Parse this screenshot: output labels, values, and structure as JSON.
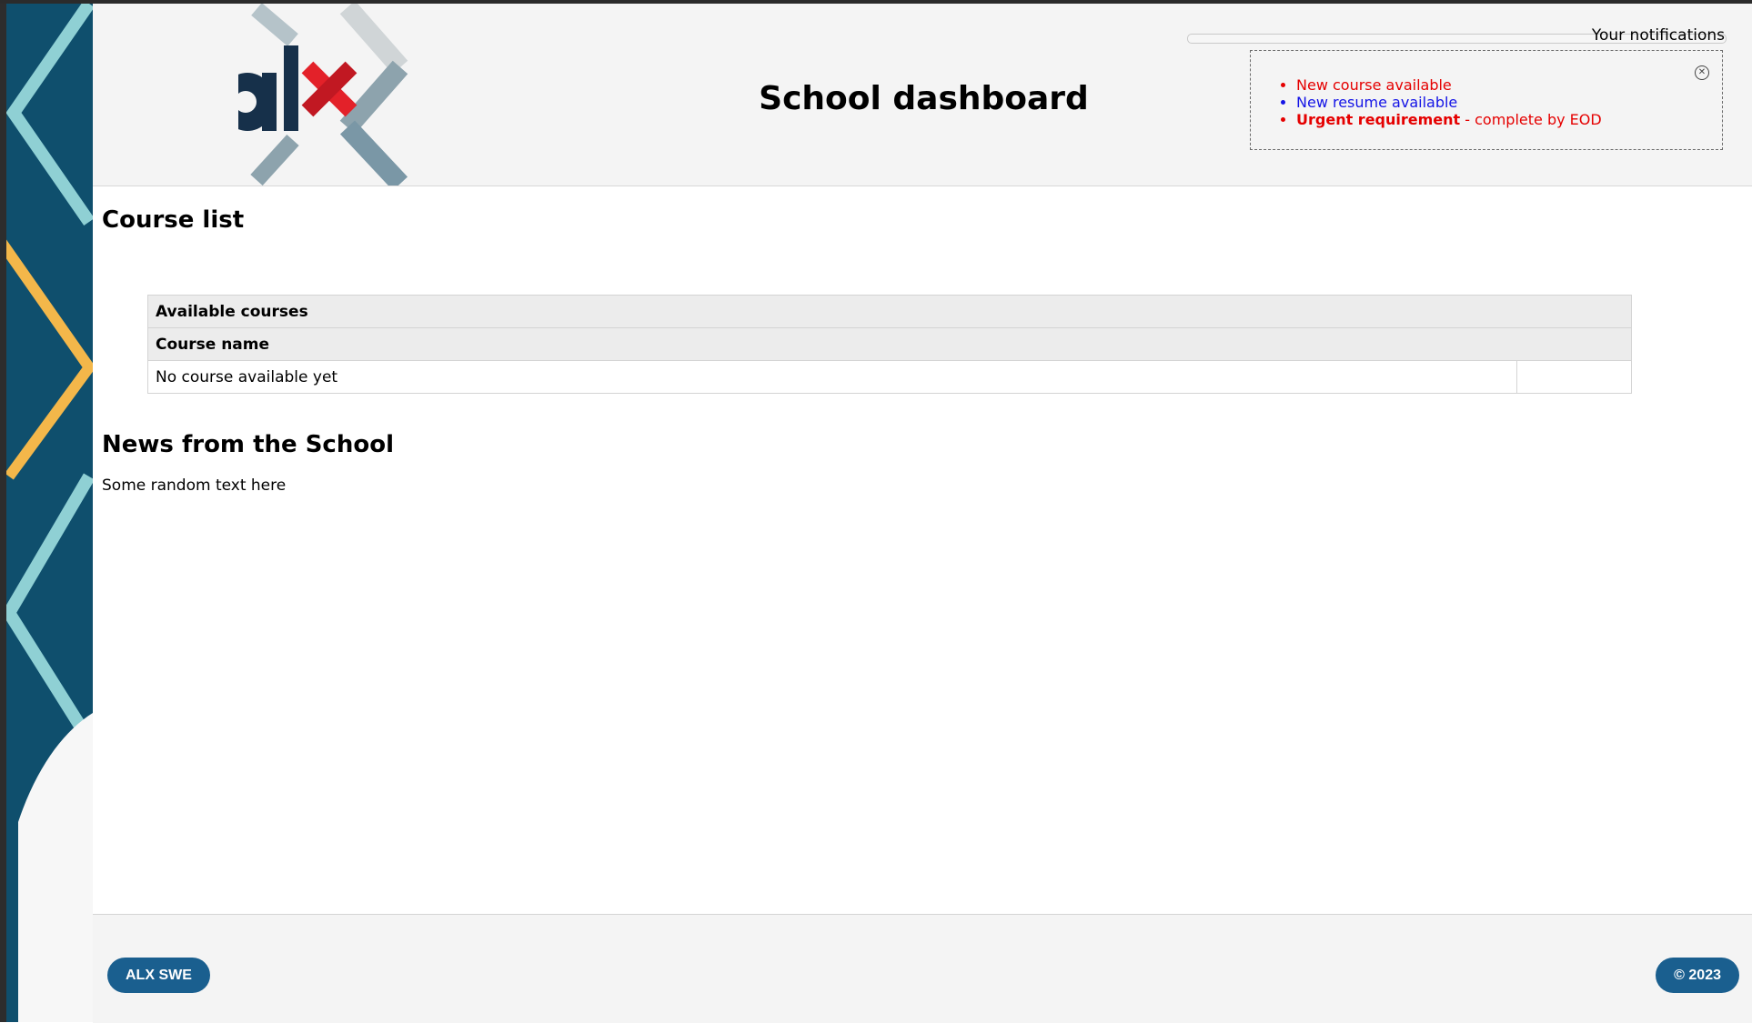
{
  "brand": {
    "logo_text": "alx",
    "colors": {
      "navy": "#16304a",
      "red": "#e32129",
      "chevron": "#7a97a6",
      "footer_pill": "#1a5f8f",
      "left_pane": "#0f4f6d"
    }
  },
  "header": {
    "title": "School dashboard"
  },
  "notifications": {
    "label": "Your notifications",
    "items": [
      {
        "text": "New course available",
        "priority": "default"
      },
      {
        "text": "New resume available",
        "priority": "default"
      },
      {
        "html_bold": "Urgent requirement",
        "text": " - complete by EOD",
        "priority": "urgent"
      }
    ]
  },
  "course_list": {
    "heading": "Course list",
    "table": {
      "caption": "Available courses",
      "column": "Course name",
      "empty_message": "No course available yet"
    }
  },
  "news": {
    "heading": "News from the School",
    "text": "Some random text here"
  },
  "footer": {
    "left_label": "ALX SWE",
    "right_label": "© 2023"
  }
}
